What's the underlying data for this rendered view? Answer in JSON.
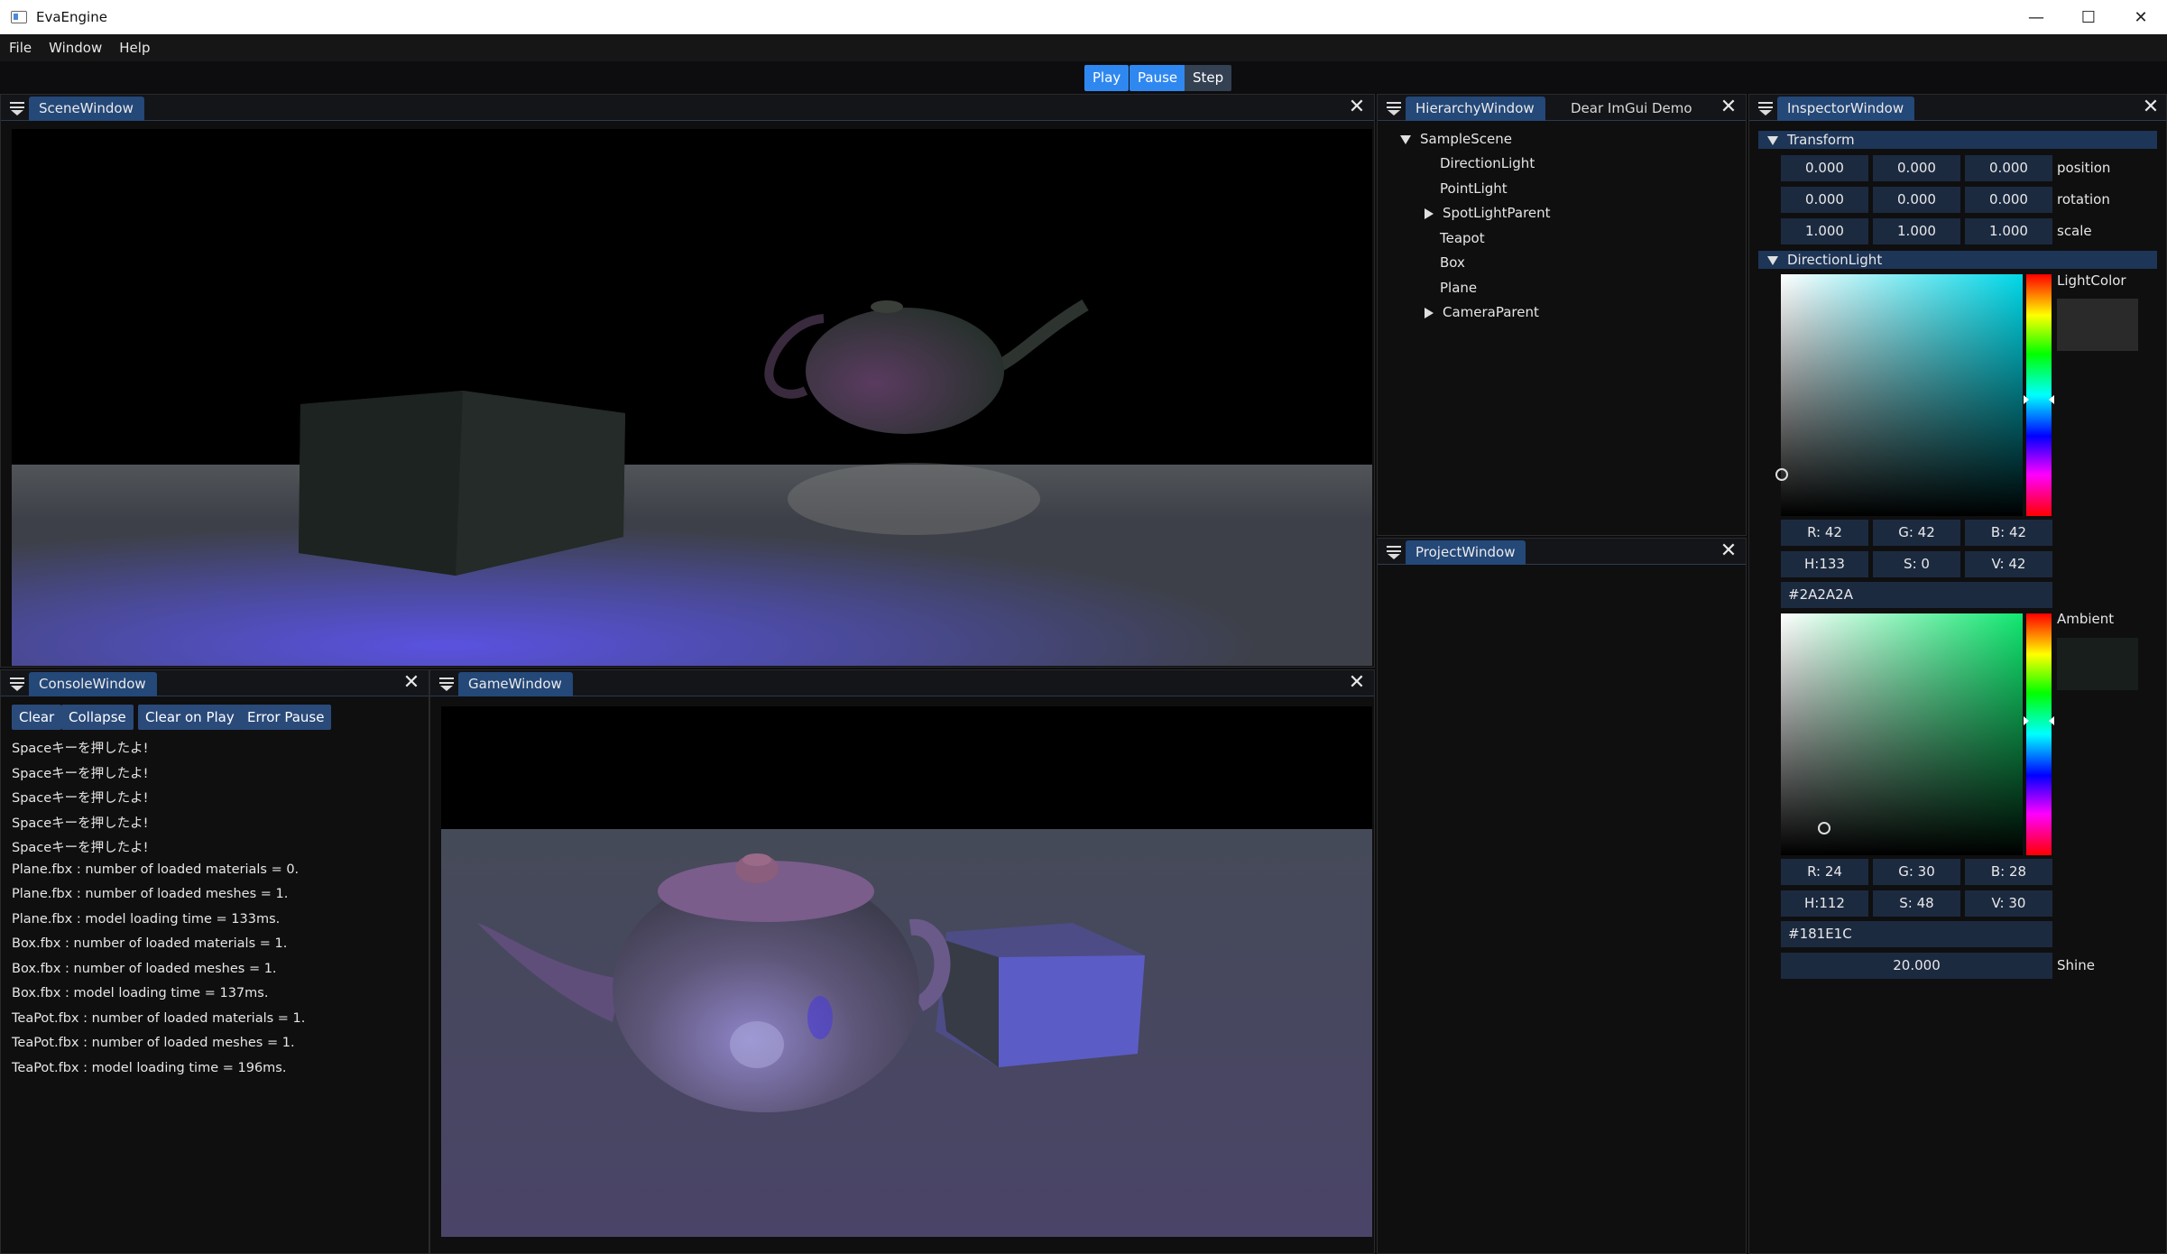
{
  "window": {
    "title": "EvaEngine",
    "minimize": "—",
    "maximize": "☐",
    "close": "✕"
  },
  "menu": [
    "File",
    "Window",
    "Help"
  ],
  "toolbar": {
    "play": "Play",
    "pause": "Pause",
    "step": "Step"
  },
  "scene_window": {
    "tab": "SceneWindow"
  },
  "hierarchy": {
    "tab": "HierarchyWindow",
    "tab2": "Dear ImGui Demo",
    "items": [
      {
        "label": "SampleScene"
      },
      {
        "label": "DirectionLight"
      },
      {
        "label": "PointLight"
      },
      {
        "label": "SpotLightParent"
      },
      {
        "label": "Teapot"
      },
      {
        "label": "Box"
      },
      {
        "label": "Plane"
      },
      {
        "label": "CameraParent"
      }
    ]
  },
  "project": {
    "tab": "ProjectWindow"
  },
  "console": {
    "tab": "ConsoleWindow",
    "buttons": {
      "clear": "Clear",
      "collapse": "Collapse",
      "clear_on_play": "Clear on Play",
      "error_pause": "Error Pause"
    },
    "lines": [
      "Spaceキーを押したよ!",
      "Spaceキーを押したよ!",
      "Spaceキーを押したよ!",
      "Spaceキーを押したよ!",
      "Spaceキーを押したよ!",
      "Plane.fbx : number of loaded materials = 0.",
      "Plane.fbx : number of loaded meshes = 1.",
      "Plane.fbx : model loading time = 133ms.",
      "Box.fbx : number of loaded materials = 1.",
      "Box.fbx : number of loaded meshes = 1.",
      "Box.fbx : model loading time = 137ms.",
      "TeaPot.fbx : number of loaded materials = 1.",
      "TeaPot.fbx : number of loaded meshes = 1.",
      "TeaPot.fbx : model loading time = 196ms."
    ]
  },
  "game_window": {
    "tab": "GameWindow"
  },
  "inspector": {
    "tab": "InspectorWindow",
    "transform": {
      "header": "Transform",
      "position": {
        "label": "position",
        "x": "0.000",
        "y": "0.000",
        "z": "0.000"
      },
      "rotation": {
        "label": "rotation",
        "x": "0.000",
        "y": "0.000",
        "z": "0.000"
      },
      "scale": {
        "label": "scale",
        "x": "1.000",
        "y": "1.000",
        "z": "1.000"
      }
    },
    "direction_light": {
      "header": "DirectionLight",
      "light_color": {
        "label": "LightColor",
        "r": "R: 42",
        "g": "G: 42",
        "b": "B: 42",
        "h": "H:133",
        "s": "S:  0",
        "v": "V: 42",
        "hex": "#2A2A2A",
        "hue_color": "#00d8e8",
        "swatch": "#2a2a2a"
      },
      "ambient": {
        "label": "Ambient",
        "r": "R: 24",
        "g": "G: 30",
        "b": "B: 28",
        "h": "H:112",
        "s": "S: 48",
        "v": "V: 30",
        "hex": "#181E1C",
        "hue_color": "#10e870",
        "swatch": "#181e1c"
      },
      "shine": {
        "label": "Shine",
        "value": "20.000"
      }
    }
  },
  "colors": {
    "accent": "#2f88f0",
    "tab_active": "#244878",
    "field_bg": "#1c2a40"
  }
}
